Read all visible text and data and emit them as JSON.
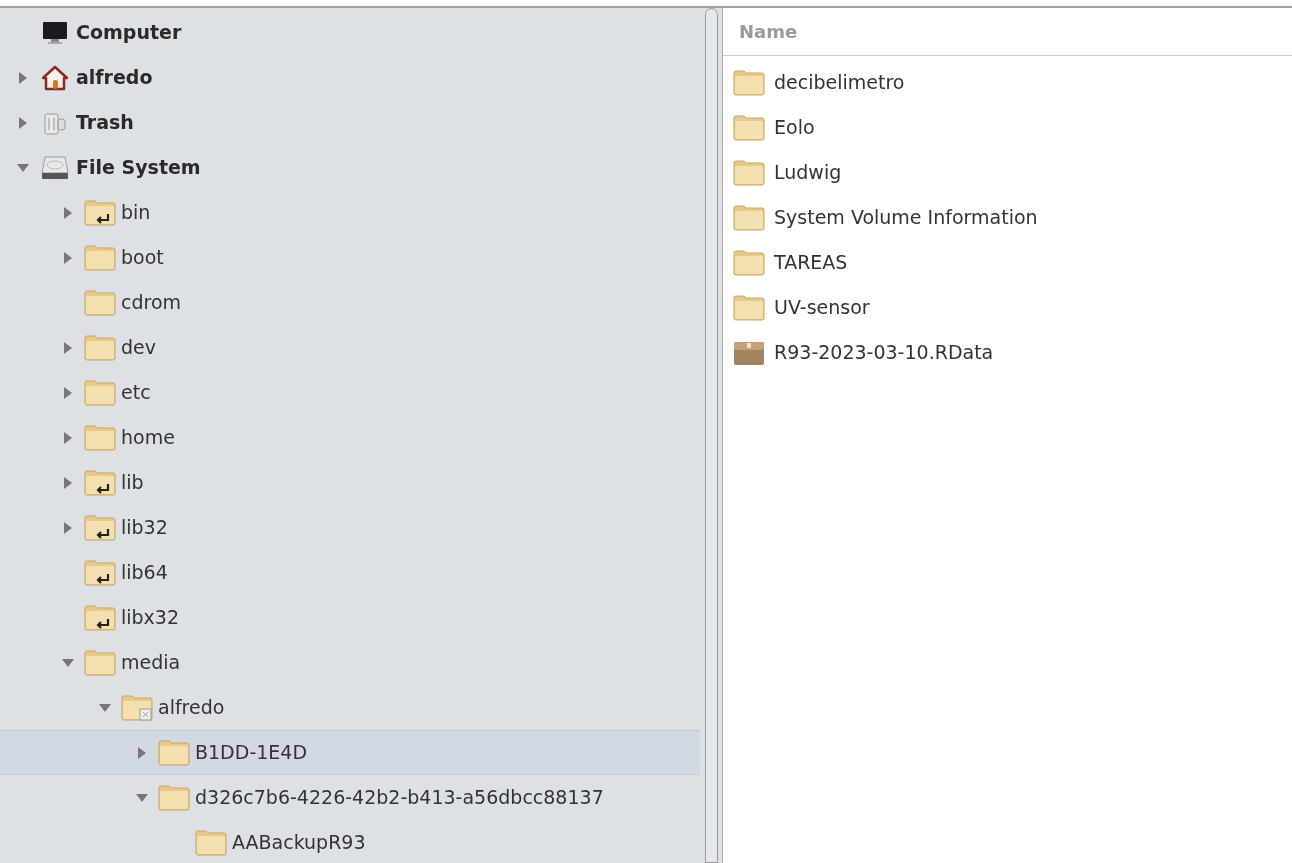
{
  "tree": [
    {
      "name": "Computer",
      "kind": "computer",
      "selected": false
    },
    {
      "name": "alfredo",
      "kind": "home",
      "expanded": false,
      "selected": false
    },
    {
      "name": "Trash",
      "kind": "trash",
      "expanded": false,
      "selected": false
    },
    {
      "name": "File System",
      "kind": "drive",
      "expanded": true,
      "selected": false,
      "children": [
        {
          "name": "bin",
          "kind": "folder-link",
          "expanded": false,
          "selected": false
        },
        {
          "name": "boot",
          "kind": "folder",
          "expanded": false,
          "selected": false
        },
        {
          "name": "cdrom",
          "kind": "folder",
          "selected": false
        },
        {
          "name": "dev",
          "kind": "folder",
          "expanded": false,
          "selected": false
        },
        {
          "name": "etc",
          "kind": "folder",
          "expanded": false,
          "selected": false
        },
        {
          "name": "home",
          "kind": "folder",
          "expanded": false,
          "selected": false
        },
        {
          "name": "lib",
          "kind": "folder-link",
          "expanded": false,
          "selected": false
        },
        {
          "name": "lib32",
          "kind": "folder-link",
          "expanded": false,
          "selected": false
        },
        {
          "name": "lib64",
          "kind": "folder-link",
          "selected": false
        },
        {
          "name": "libx32",
          "kind": "folder-link",
          "selected": false
        },
        {
          "name": "media",
          "kind": "folder",
          "expanded": true,
          "selected": false,
          "children": [
            {
              "name": "alfredo",
              "kind": "folder-locked",
              "expanded": true,
              "selected": false,
              "children": [
                {
                  "name": "B1DD-1E4D",
                  "kind": "folder",
                  "expanded": false,
                  "selected": true
                },
                {
                  "name": "d326c7b6-4226-42b2-b413-a56dbcc88137",
                  "kind": "folder",
                  "expanded": true,
                  "selected": false,
                  "children": [
                    {
                      "name": "AABackupR93",
                      "kind": "folder",
                      "selected": false
                    }
                  ]
                }
              ]
            }
          ]
        }
      ]
    }
  ],
  "files": {
    "columns": [
      "Name"
    ],
    "rows": [
      {
        "name": "decibelimetro",
        "kind": "folder"
      },
      {
        "name": "Eolo",
        "kind": "folder"
      },
      {
        "name": "Ludwig",
        "kind": "folder"
      },
      {
        "name": "System Volume Information",
        "kind": "folder"
      },
      {
        "name": "TAREAS",
        "kind": "folder"
      },
      {
        "name": "UV-sensor",
        "kind": "folder"
      },
      {
        "name": "R93-2023-03-10.RData",
        "kind": "package"
      }
    ]
  }
}
